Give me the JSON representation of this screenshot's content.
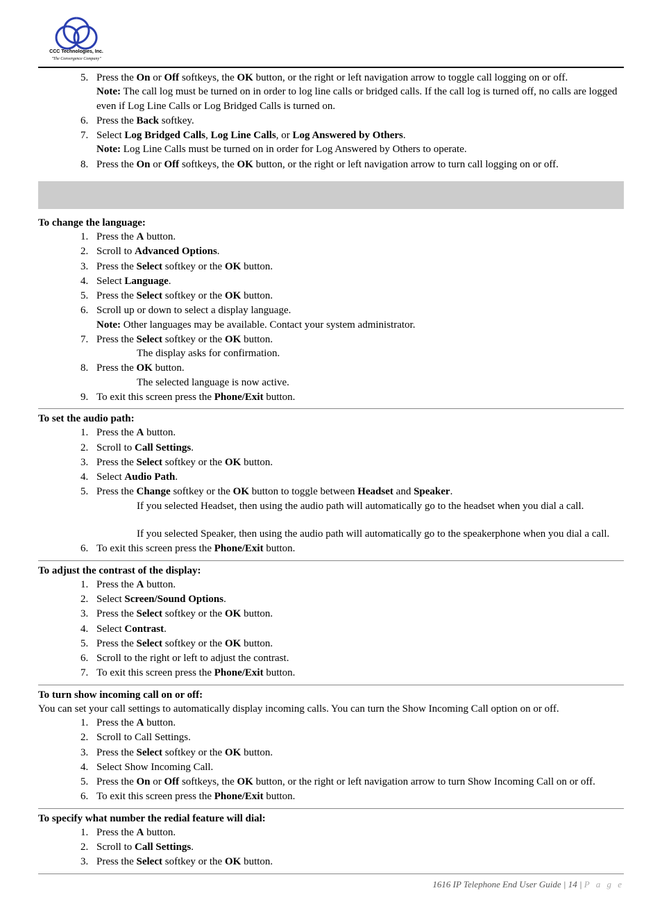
{
  "logo": {
    "company_name": "CCC Technologies, Inc.",
    "tagline": "\"The Convergence Company\""
  },
  "top_list_start": 5,
  "top_items": [
    {
      "parts": [
        "Press the ",
        {
          "b": "On"
        },
        " or ",
        {
          "b": "Off"
        },
        " softkeys, the ",
        {
          "b": "OK"
        },
        " button, or the right or left navigation arrow to toggle call logging on or off."
      ],
      "note": [
        {
          "b": "Note:"
        },
        " The call log must be turned on in order to log line calls or bridged calls. If the call log is turned off, no calls are logged even if Log Line Calls or Log Bridged Calls is turned on."
      ]
    },
    {
      "parts": [
        "Press the ",
        {
          "b": "Back"
        },
        " softkey."
      ]
    },
    {
      "parts": [
        "Select ",
        {
          "b": "Log Bridged Calls"
        },
        ", ",
        {
          "b": "Log Line Calls"
        },
        ", or ",
        {
          "b": "Log Answered by Others"
        },
        "."
      ],
      "note": [
        {
          "b": "Note:"
        },
        " Log Line Calls must be turned on in order for Log Answered by Others to operate."
      ]
    },
    {
      "parts": [
        "Press the ",
        {
          "b": "On"
        },
        " or ",
        {
          "b": "Off"
        },
        " softkeys, the ",
        {
          "b": "OK"
        },
        " button, or the right or left navigation arrow to turn call logging on or off."
      ]
    }
  ],
  "sections": [
    {
      "heading": "To change the language:",
      "list_start": 1,
      "items": [
        {
          "parts": [
            "Press the ",
            {
              "b": "A"
            },
            " button."
          ]
        },
        {
          "parts": [
            "Scroll to ",
            {
              "b": "Advanced Options"
            },
            "."
          ]
        },
        {
          "parts": [
            "Press the ",
            {
              "b": "Select"
            },
            " softkey or the ",
            {
              "b": "OK"
            },
            " button."
          ]
        },
        {
          "parts": [
            "Select ",
            {
              "b": "Language"
            },
            "."
          ]
        },
        {
          "parts": [
            "Press the ",
            {
              "b": "Select"
            },
            " softkey or the ",
            {
              "b": "OK"
            },
            " button."
          ]
        },
        {
          "parts": [
            "Scroll up or down to select a display language."
          ],
          "note": [
            {
              "b": "Note:"
            },
            " Other languages may be available. Contact your system administrator."
          ]
        },
        {
          "parts": [
            "Press the ",
            {
              "b": "Select"
            },
            " softkey or the ",
            {
              "b": "OK"
            },
            " button."
          ],
          "sub": [
            "The display asks for confirmation."
          ]
        },
        {
          "parts": [
            "Press the ",
            {
              "b": "OK"
            },
            " button."
          ],
          "sub": [
            "The selected language is now active."
          ]
        },
        {
          "parts": [
            "To exit this screen press the ",
            {
              "b": "Phone/Exit"
            },
            " button."
          ]
        }
      ]
    },
    {
      "heading": "To set the audio path:",
      "list_start": 1,
      "items": [
        {
          "parts": [
            "Press the ",
            {
              "b": "A"
            },
            " button."
          ]
        },
        {
          "parts": [
            "Scroll to ",
            {
              "b": "Call Settings"
            },
            "."
          ]
        },
        {
          "parts": [
            "Press the ",
            {
              "b": "Select"
            },
            " softkey or the ",
            {
              "b": "OK"
            },
            " button."
          ]
        },
        {
          "parts": [
            "Select ",
            {
              "b": "Audio Path"
            },
            "."
          ]
        },
        {
          "parts": [
            "Press the ",
            {
              "b": "Change"
            },
            " softkey or the ",
            {
              "b": "OK"
            },
            " button to toggle between ",
            {
              "b": "Headset"
            },
            " and ",
            {
              "b": "Speaker"
            },
            "."
          ],
          "sub": [
            "If you selected Headset, then using the audio path will automatically go to the headset when you dial a call.",
            "If you selected Speaker, then using the audio path will automatically go to the speakerphone when you dial a call."
          ]
        },
        {
          "parts": [
            "To exit this screen press the ",
            {
              "b": "Phone/Exit"
            },
            " button."
          ]
        }
      ]
    },
    {
      "heading": "To adjust the contrast of the display:",
      "list_start": 1,
      "items": [
        {
          "parts": [
            "Press the ",
            {
              "b": "A"
            },
            " button."
          ]
        },
        {
          "parts": [
            "Select ",
            {
              "b": "Screen/Sound Options"
            },
            "."
          ]
        },
        {
          "parts": [
            "Press the ",
            {
              "b": "Select"
            },
            " softkey or the ",
            {
              "b": "OK"
            },
            " button."
          ]
        },
        {
          "parts": [
            "Select ",
            {
              "b": "Contrast"
            },
            "."
          ]
        },
        {
          "parts": [
            "Press the ",
            {
              "b": "Select"
            },
            " softkey or the ",
            {
              "b": "OK"
            },
            " button."
          ]
        },
        {
          "parts": [
            "Scroll to the right or left to adjust the contrast."
          ]
        },
        {
          "parts": [
            "To exit this screen press the ",
            {
              "b": "Phone/Exit"
            },
            " button."
          ]
        }
      ]
    },
    {
      "heading": "To turn show incoming call on or off:",
      "intro": "You can set your call settings to automatically display incoming calls. You can turn the Show Incoming Call option on or off.",
      "list_start": 1,
      "items": [
        {
          "parts": [
            "Press the ",
            {
              "b": "A"
            },
            " button."
          ]
        },
        {
          "parts": [
            "Scroll to Call Settings."
          ]
        },
        {
          "parts": [
            "Press the ",
            {
              "b": "Select"
            },
            " softkey or the ",
            {
              "b": "OK"
            },
            " button."
          ]
        },
        {
          "parts": [
            "Select Show Incoming Call."
          ]
        },
        {
          "parts": [
            "Press the ",
            {
              "b": "On"
            },
            " or ",
            {
              "b": "Off"
            },
            " softkeys, the ",
            {
              "b": "OK"
            },
            " button, or the right or left navigation arrow to turn Show Incoming Call on or off."
          ]
        },
        {
          "parts": [
            "To exit this screen press the ",
            {
              "b": "Phone/Exit"
            },
            " button."
          ]
        }
      ]
    },
    {
      "heading": "To specify what number the redial feature will dial:",
      "list_start": 1,
      "items": [
        {
          "parts": [
            "Press the ",
            {
              "b": "A"
            },
            " button."
          ]
        },
        {
          "parts": [
            "Scroll to ",
            {
              "b": "Call Settings"
            },
            "."
          ]
        },
        {
          "parts": [
            "Press the ",
            {
              "b": "Select"
            },
            " softkey or the ",
            {
              "b": "OK"
            },
            " button."
          ]
        }
      ]
    }
  ],
  "footer": {
    "doc_title": "1616 IP Telephone End User Guide",
    "page_num": "14",
    "page_word": "P a g e"
  }
}
